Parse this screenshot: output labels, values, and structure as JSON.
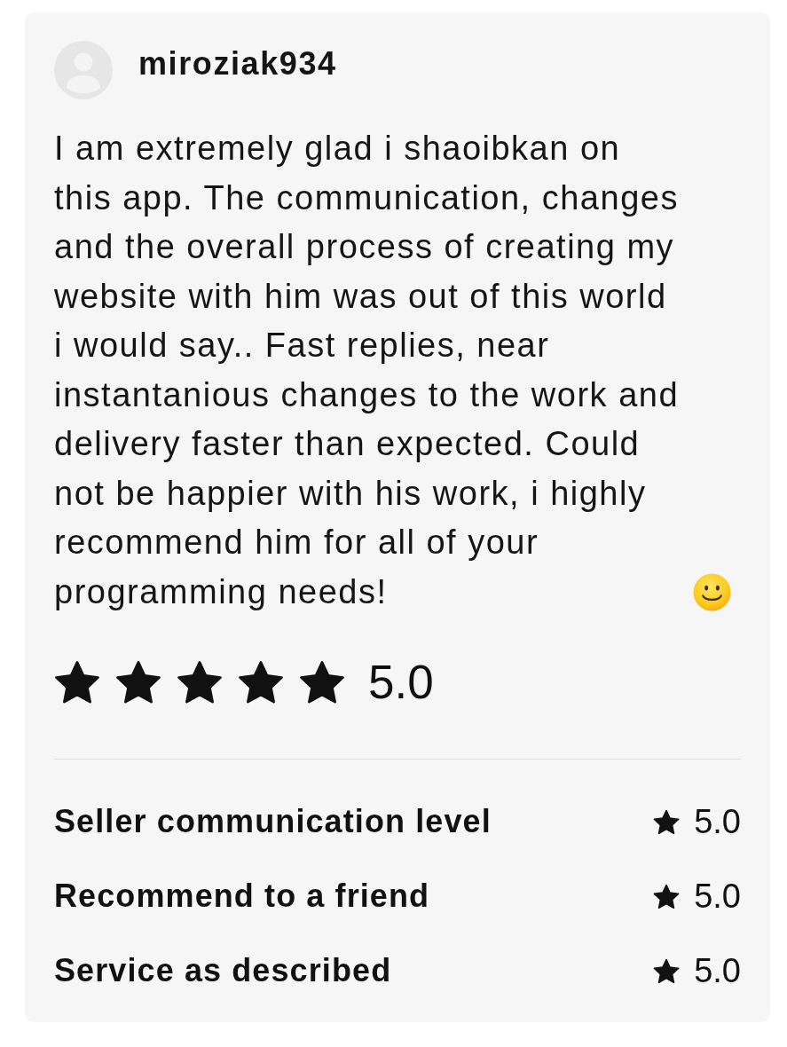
{
  "review": {
    "reviewer": {
      "name": "miroziak934"
    },
    "text": "I am extremely glad i shaoibkan on this app. The communication, changes and the overall process of creating my website with him was out of this world i would say.. Fast replies, near instantanious changes to the work and delivery faster than expected. Could not be happier with his work, i highly recommend him for all of your programming needs!",
    "rating": {
      "stars": 5,
      "value": "5.0"
    },
    "breakdown": [
      {
        "label": "Seller communication level",
        "value": "5.0"
      },
      {
        "label": "Recommend to a friend",
        "value": "5.0"
      },
      {
        "label": "Service as described",
        "value": "5.0"
      }
    ]
  }
}
